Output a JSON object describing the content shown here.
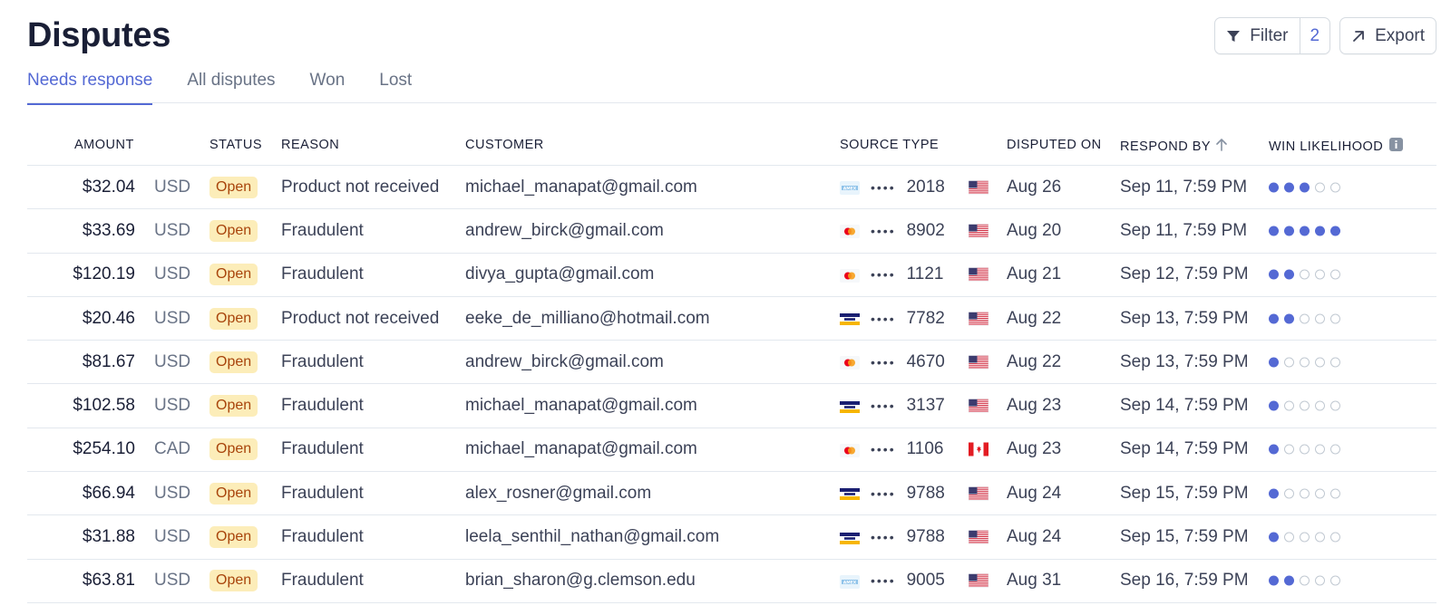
{
  "page": {
    "title": "Disputes"
  },
  "toolbar": {
    "filter_label": "Filter",
    "filter_count": "2",
    "export_label": "Export"
  },
  "tabs": [
    {
      "label": "Needs response",
      "active": true
    },
    {
      "label": "All disputes",
      "active": false
    },
    {
      "label": "Won",
      "active": false
    },
    {
      "label": "Lost",
      "active": false
    }
  ],
  "columns": {
    "amount": "AMOUNT",
    "status": "STATUS",
    "reason": "REASON",
    "customer": "CUSTOMER",
    "source_type": "SOURCE TYPE",
    "disputed_on": "DISPUTED ON",
    "respond_by": "RESPOND BY",
    "win_likelihood": "WIN LIKELIHOOD"
  },
  "colors": {
    "accent": "#5469d4",
    "badge_bg": "#fcedb9",
    "badge_text": "#a8440b"
  },
  "rows": [
    {
      "amount": "$32.04",
      "currency": "USD",
      "status": "Open",
      "reason": "Product not received",
      "customer": "michael_manapat@gmail.com",
      "card_brand": "amex-icon",
      "card_dots": "••••",
      "card_last4": "2018",
      "country": "us-flag-icon",
      "disputed_on": "Aug 26",
      "respond_by": "Sep 11, 7:59 PM",
      "win_likelihood": 3
    },
    {
      "amount": "$33.69",
      "currency": "USD",
      "status": "Open",
      "reason": "Fraudulent",
      "customer": "andrew_birck@gmail.com",
      "card_brand": "mastercard-icon",
      "card_dots": "••••",
      "card_last4": "8902",
      "country": "us-flag-icon",
      "disputed_on": "Aug 20",
      "respond_by": "Sep 11, 7:59 PM",
      "win_likelihood": 5
    },
    {
      "amount": "$120.19",
      "currency": "USD",
      "status": "Open",
      "reason": "Fraudulent",
      "customer": "divya_gupta@gmail.com",
      "card_brand": "mastercard-icon",
      "card_dots": "••••",
      "card_last4": "1121",
      "country": "us-flag-icon",
      "disputed_on": "Aug 21",
      "respond_by": "Sep 12, 7:59 PM",
      "win_likelihood": 2
    },
    {
      "amount": "$20.46",
      "currency": "USD",
      "status": "Open",
      "reason": "Product not received",
      "customer": "eeke_de_milliano@hotmail.com",
      "card_brand": "visa-icon",
      "card_dots": "••••",
      "card_last4": "7782",
      "country": "us-flag-icon",
      "disputed_on": "Aug 22",
      "respond_by": "Sep 13, 7:59 PM",
      "win_likelihood": 2
    },
    {
      "amount": "$81.67",
      "currency": "USD",
      "status": "Open",
      "reason": "Fraudulent",
      "customer": "andrew_birck@gmail.com",
      "card_brand": "mastercard-icon",
      "card_dots": "••••",
      "card_last4": "4670",
      "country": "us-flag-icon",
      "disputed_on": "Aug 22",
      "respond_by": "Sep 13, 7:59 PM",
      "win_likelihood": 1
    },
    {
      "amount": "$102.58",
      "currency": "USD",
      "status": "Open",
      "reason": "Fraudulent",
      "customer": "michael_manapat@gmail.com",
      "card_brand": "visa-icon",
      "card_dots": "••••",
      "card_last4": "3137",
      "country": "us-flag-icon",
      "disputed_on": "Aug 23",
      "respond_by": "Sep 14, 7:59 PM",
      "win_likelihood": 1
    },
    {
      "amount": "$254.10",
      "currency": "CAD",
      "status": "Open",
      "reason": "Fraudulent",
      "customer": "michael_manapat@gmail.com",
      "card_brand": "mastercard-icon",
      "card_dots": "••••",
      "card_last4": "1106",
      "country": "ca-flag-icon",
      "disputed_on": "Aug 23",
      "respond_by": "Sep 14, 7:59 PM",
      "win_likelihood": 1
    },
    {
      "amount": "$66.94",
      "currency": "USD",
      "status": "Open",
      "reason": "Fraudulent",
      "customer": "alex_rosner@gmail.com",
      "card_brand": "visa-icon",
      "card_dots": "••••",
      "card_last4": "9788",
      "country": "us-flag-icon",
      "disputed_on": "Aug 24",
      "respond_by": "Sep 15, 7:59 PM",
      "win_likelihood": 1
    },
    {
      "amount": "$31.88",
      "currency": "USD",
      "status": "Open",
      "reason": "Fraudulent",
      "customer": "leela_senthil_nathan@gmail.com",
      "card_brand": "visa-icon",
      "card_dots": "••••",
      "card_last4": "9788",
      "country": "us-flag-icon",
      "disputed_on": "Aug 24",
      "respond_by": "Sep 15, 7:59 PM",
      "win_likelihood": 1
    },
    {
      "amount": "$63.81",
      "currency": "USD",
      "status": "Open",
      "reason": "Fraudulent",
      "customer": "brian_sharon@g.clemson.edu",
      "card_brand": "amex-icon",
      "card_dots": "••••",
      "card_last4": "9005",
      "country": "us-flag-icon",
      "disputed_on": "Aug 31",
      "respond_by": "Sep 16, 7:59 PM",
      "win_likelihood": 2
    }
  ]
}
